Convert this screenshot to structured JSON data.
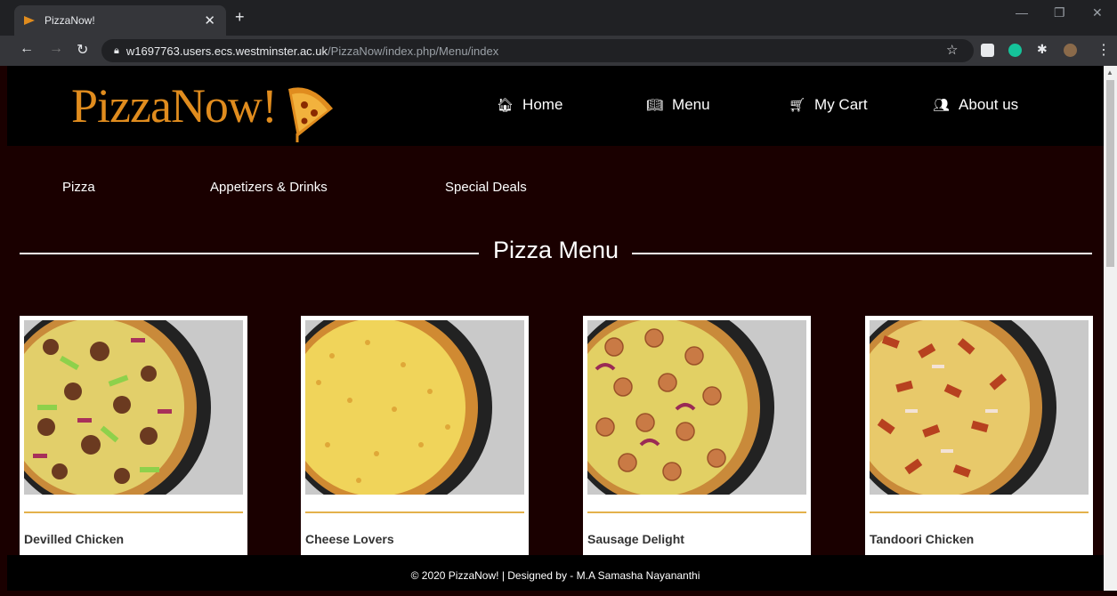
{
  "browser": {
    "tab_title": "PizzaNow!",
    "tab_close": "✕",
    "new_tab": "+",
    "url_host": "w1697763.users.ecs.westminster.ac.uk",
    "url_path": "/PizzaNow/index.php/Menu/index"
  },
  "site": {
    "logo_text": "PizzaNow!",
    "nav": [
      {
        "label": "Home",
        "icon": "home-icon"
      },
      {
        "label": "Menu",
        "icon": "book-icon"
      },
      {
        "label": "My Cart",
        "icon": "cart-icon"
      },
      {
        "label": "About us",
        "icon": "users-icon"
      }
    ],
    "subnav": [
      "Pizza",
      "Appetizers & Drinks",
      "Special Deals"
    ],
    "section_title": "Pizza Menu",
    "cards": [
      {
        "name": "Devilled Chicken"
      },
      {
        "name": "Cheese Lovers"
      },
      {
        "name": "Sausage Delight"
      },
      {
        "name": "Tandoori Chicken"
      }
    ],
    "footer": "© 2020 PizzaNow! | Designed by - M.A Samasha Nayananthi"
  },
  "colors": {
    "brand": "#e08c1e",
    "background": "#1a0000",
    "header": "#000000",
    "card_rule": "#e3b14b"
  }
}
